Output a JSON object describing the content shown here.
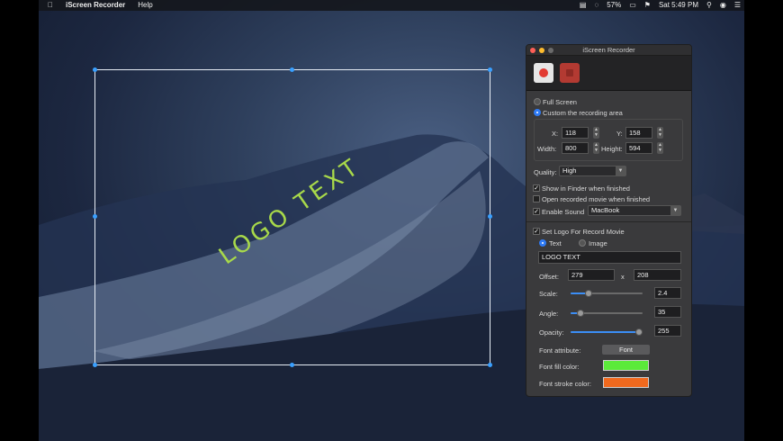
{
  "menubar": {
    "app_name": "iScreen Recorder",
    "menu_help": "Help",
    "battery": "57%",
    "clock": "Sat 5:49 PM"
  },
  "canvas": {
    "logo_text": "LOGO TEXT"
  },
  "panel": {
    "title": "iScreen Recorder",
    "full_screen_label": "Full Screen",
    "custom_area_label": "Custom the recording area",
    "x_label": "X:",
    "x_value": "118",
    "y_label": "Y:",
    "y_value": "158",
    "width_label": "Width:",
    "width_value": "800",
    "height_label": "Height:",
    "height_value": "594",
    "quality_label": "Quality:",
    "quality_value": "High",
    "show_in_finder_label": "Show in Finder when finished",
    "open_movie_label": "Open recorded movie when finished",
    "enable_sound_label": "Enable Sound",
    "sound_device": "MacBook",
    "set_logo_label": "Set Logo For Record Movie",
    "text_option": "Text",
    "image_option": "Image",
    "logo_text_value": "LOGO TEXT",
    "offset_label": "Offset:",
    "offset_x": "279",
    "offset_sep": "x",
    "offset_y": "208",
    "scale_label": "Scale:",
    "scale_value": "2.4",
    "angle_label": "Angle:",
    "angle_value": "35",
    "opacity_label": "Opacity:",
    "opacity_value": "255",
    "font_attribute_label": "Font attribute:",
    "font_button": "Font",
    "font_fill_label": "Font fill color:",
    "font_stroke_label": "Font stroke color:"
  },
  "colors": {
    "fill": "#5bea3a",
    "stroke": "#f0691e",
    "logo": "#a8d94a",
    "accent": "#2f7bf5"
  },
  "sliders": {
    "scale": 0.22,
    "angle": 0.1,
    "opacity": 1.0
  }
}
